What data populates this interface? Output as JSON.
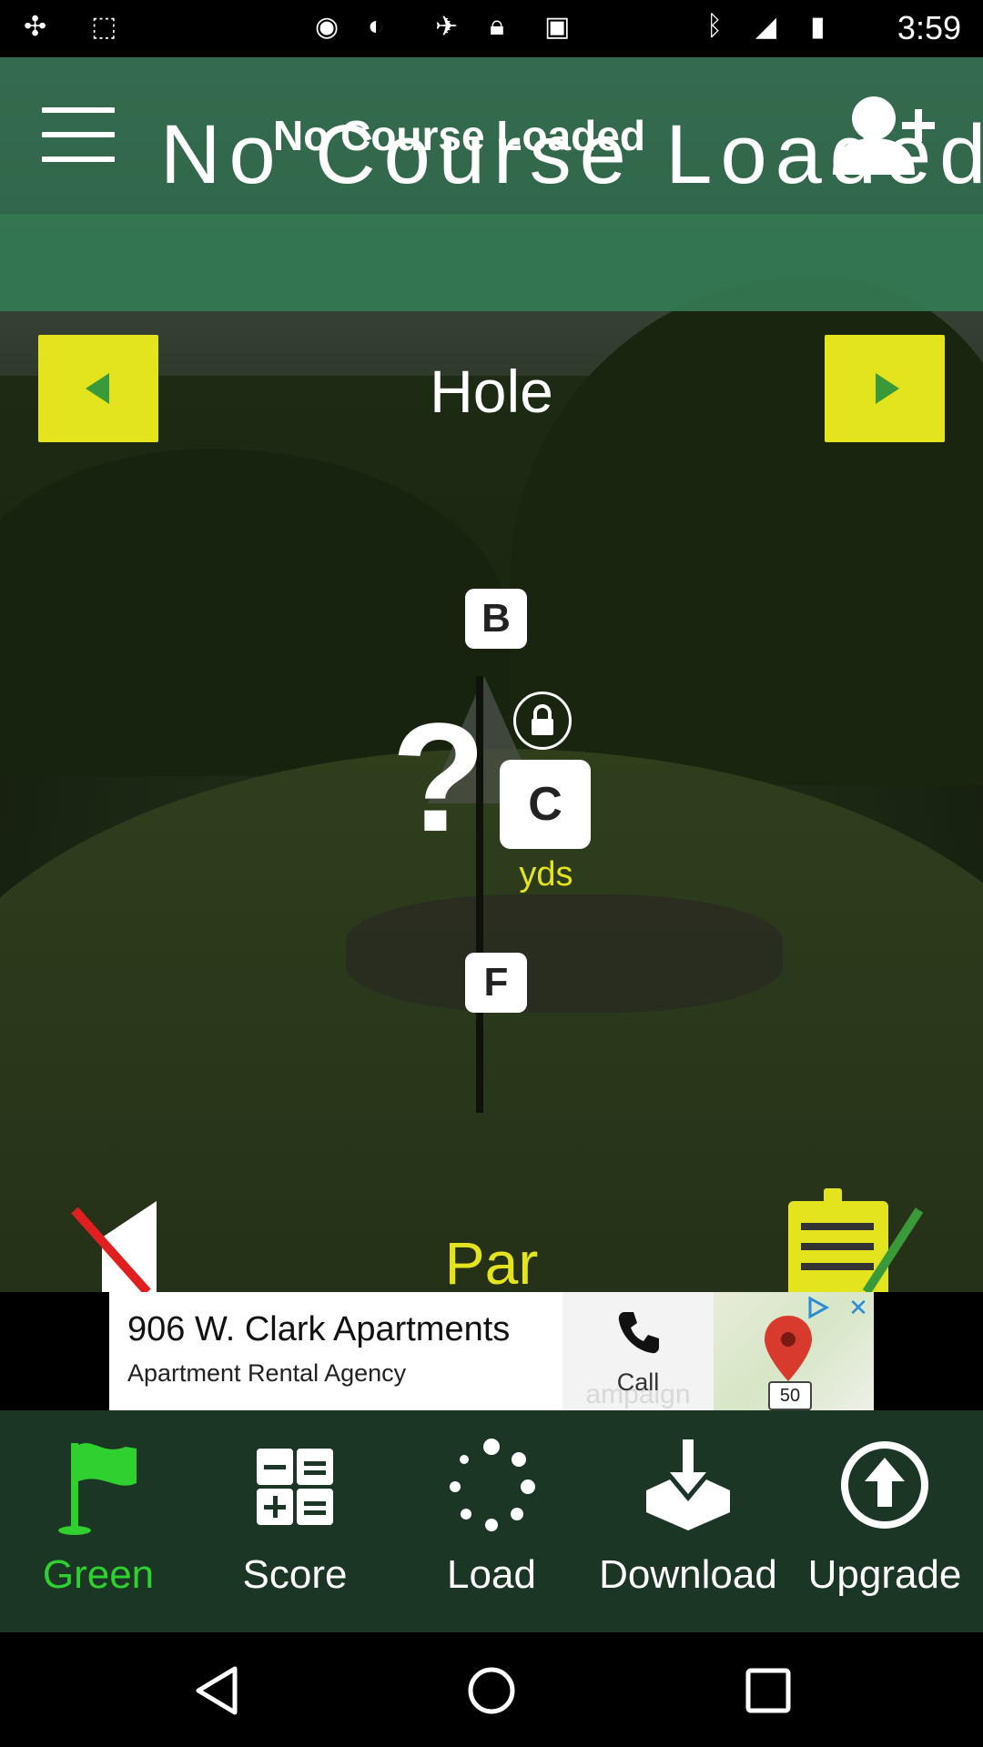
{
  "status_bar": {
    "time": "3:59",
    "icons": [
      "fan-notification-icon",
      "media-icon",
      "sync-icon",
      "satellite-icon",
      "lock-icon",
      "android-icon",
      "bluetooth-icon",
      "signal-icon",
      "battery-icon"
    ]
  },
  "header": {
    "course_title": "No Course Loaded",
    "course_title_overlay": "No Course Loaded",
    "menu_icon": "hamburger-menu-icon",
    "add_player_icon": "add-user-icon"
  },
  "hole_nav": {
    "label": "Hole",
    "prev_icon": "arrow-left-icon",
    "next_icon": "arrow-right-icon",
    "button_color": "#e3e41e",
    "arrow_color": "#3a9a3a"
  },
  "distances": {
    "back_label": "B",
    "center_label": "C",
    "front_label": "F",
    "value": "?",
    "unit": "yds",
    "lock_icon": "lock-icon"
  },
  "hole_info": {
    "par_label": "Par",
    "sound_icon": "mute-icon",
    "scorecard_icon": "scorecard-icon"
  },
  "ad": {
    "title": "906 W. Clark Apartments",
    "subtitle": "Apartment Rental Agency",
    "call_label": "Call",
    "map_background_text": "ampaign",
    "route_badge": "50"
  },
  "tabs": [
    {
      "label": "Green",
      "icon": "flag-icon",
      "active": true
    },
    {
      "label": "Score",
      "icon": "calculator-icon",
      "active": false
    },
    {
      "label": "Load",
      "icon": "loading-dots-icon",
      "active": false
    },
    {
      "label": "Download",
      "icon": "download-icon",
      "active": false
    },
    {
      "label": "Upgrade",
      "icon": "upgrade-arrow-icon",
      "active": false
    }
  ],
  "colors": {
    "header_green": "#306e4e",
    "accent_yellow": "#e3e41e",
    "active_tab": "#2fd02f",
    "tabbar_bg": "#1c3625"
  }
}
